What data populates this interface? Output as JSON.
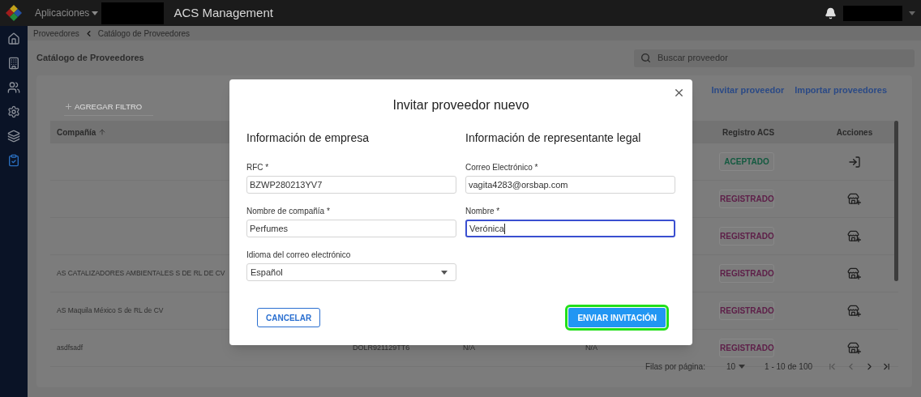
{
  "top_bar": {
    "apps_menu": "Aplicaciones",
    "title": "ACS Management"
  },
  "sidebar": {
    "items": [
      {
        "kind": "home",
        "selected": false
      },
      {
        "kind": "building",
        "selected": false
      },
      {
        "kind": "users",
        "selected": false
      },
      {
        "kind": "settings",
        "selected": false
      },
      {
        "kind": "layers",
        "selected": false
      },
      {
        "kind": "clipboard",
        "selected": true
      }
    ]
  },
  "breadcrumb": [
    "Proveedores",
    "Catálogo de Proveedores"
  ],
  "page_title": "Catálogo de Proveedores",
  "search": {
    "placeholder": "Buscar proveedor"
  },
  "actions": [
    "Invitar proveedor",
    "Importar proveedores"
  ],
  "filter_button": "AGREGAR FILTRO",
  "table": {
    "columns": {
      "company": {
        "label": "Compañía",
        "sorted": true
      },
      "registro": "Registro ACS",
      "acciones": "Acciones"
    },
    "rows": [
      {
        "status": {
          "label": "ACEPTADO",
          "kind": "accepted"
        }
      },
      {
        "status": {
          "label": "REGISTRADO",
          "kind": "registered"
        }
      },
      {
        "status": {
          "label": "REGISTRADO",
          "kind": "registered"
        }
      },
      {
        "company": "AS CATALIZADORES AMBIENTALES S DE RL DE CV",
        "status": {
          "label": "REGISTRADO",
          "kind": "registered"
        }
      },
      {
        "company": "AS Maquila México S de RL de CV",
        "status": {
          "label": "REGISTRADO",
          "kind": "registered"
        }
      },
      {
        "company": "asdfsadf",
        "rfc": "DOLR921129TT6",
        "column_3": "N/A",
        "column_4": "N/A",
        "status": {
          "label": "REGISTRADO",
          "kind": "registered"
        }
      }
    ]
  },
  "pagination": {
    "rows_label": "Filas por página:",
    "page_size": "10",
    "range": "1 - 10 de 100"
  },
  "modal": {
    "title": "Invitar proveedor nuevo",
    "sections": [
      {
        "heading": "Información de empresa",
        "fields": [
          {
            "label": "RFC *",
            "value": "BZWP280213YV7",
            "kind": "text",
            "focused": false
          },
          {
            "label": "Nombre de compañía *",
            "value": "Perfumes",
            "kind": "text",
            "focused": false
          },
          {
            "label": "Idioma del correo electrónico",
            "value": "Español",
            "kind": "select",
            "focused": false
          }
        ]
      },
      {
        "heading": "Información de representante legal",
        "fields": [
          {
            "label": "Correo Electrónico *",
            "value": "vagita4283@orsbap.com",
            "kind": "text",
            "focused": false
          },
          {
            "label": "Nombre *",
            "value": "Verónica",
            "kind": "text",
            "focused": true
          }
        ]
      }
    ],
    "cancel": "CANCELAR",
    "submit": "ENVIAR INVITACIÓN",
    "submit_highlighted": true
  }
}
